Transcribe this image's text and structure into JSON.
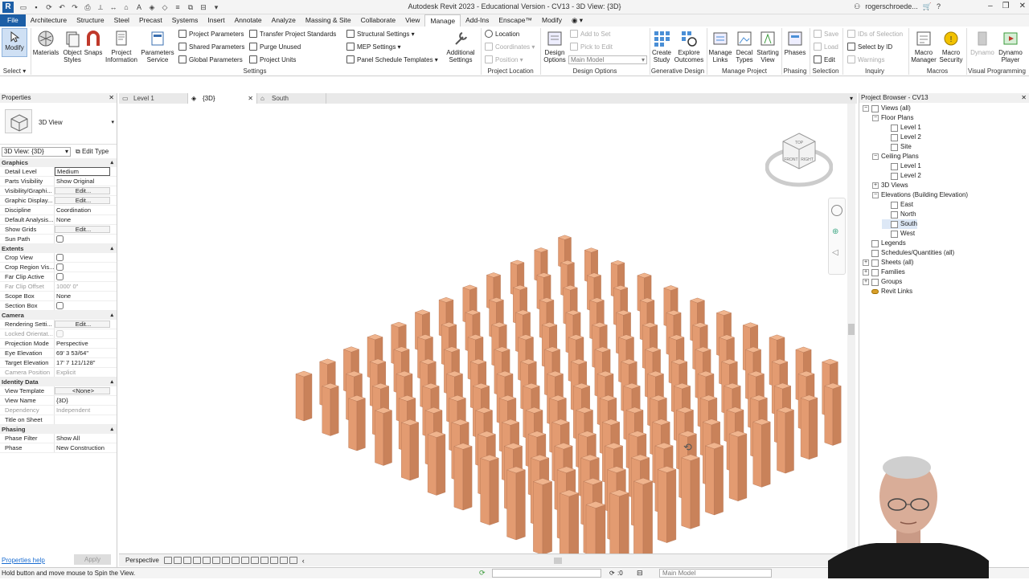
{
  "titlebar": {
    "app_logo": "R",
    "title": "Autodesk Revit 2023 - Educational Version - CV13 - 3D View: {3D}",
    "user": "rogerschroede...",
    "help": "?"
  },
  "ribbon_tabs": [
    "File",
    "Architecture",
    "Structure",
    "Steel",
    "Precast",
    "Systems",
    "Insert",
    "Annotate",
    "Analyze",
    "Massing & Site",
    "Collaborate",
    "View",
    "Manage",
    "Add-Ins",
    "Enscape™",
    "Modify"
  ],
  "active_tab": "Manage",
  "ribbon": {
    "select": {
      "modify": "Modify",
      "panel": "Select ▾"
    },
    "settings": {
      "materials": "Materials",
      "object_styles_1": "Object",
      "object_styles_2": "Styles",
      "snaps": "Snaps",
      "project_info_1": "Project",
      "project_info_2": "Information",
      "params_service_1": "Parameters",
      "params_service_2": "Service",
      "project_parameters": "Project  Parameters",
      "shared_parameters": "Shared  Parameters",
      "global_parameters": "Global  Parameters",
      "transfer_standards": "Transfer  Project Standards",
      "purge_unused": "Purge  Unused",
      "project_units": "Project  Units",
      "structural_settings": "Structural  Settings  ▾",
      "mep_settings": "MEP  Settings  ▾",
      "panel_schedule": "Panel Schedule  Templates  ▾",
      "additional_1": "Additional",
      "additional_2": "Settings",
      "panel": "Settings"
    },
    "project_location": {
      "location": "Location",
      "coordinates": "Coordinates  ▾",
      "position": "Position  ▾",
      "panel": "Project Location"
    },
    "design_options": {
      "design_1": "Design",
      "design_2": "Options",
      "add_to_set": "Add to Set",
      "pick_to_edit": "Pick to Edit",
      "main_model": "Main Model",
      "panel": "Design Options"
    },
    "generative": {
      "create_1": "Create",
      "create_2": "Study",
      "explore_1": "Explore",
      "explore_2": "Outcomes",
      "panel": "Generative Design"
    },
    "manage_project": {
      "manage_links_1": "Manage",
      "manage_links_2": "Links",
      "decal_1": "Decal",
      "decal_2": "Types",
      "starting_1": "Starting",
      "starting_2": "View",
      "panel": "Manage Project"
    },
    "phasing": {
      "phases": "Phases",
      "panel": "Phasing"
    },
    "selection": {
      "save": "Save",
      "load": "Load",
      "edit": "Edit",
      "panel": "Selection"
    },
    "inquiry": {
      "ids": "IDs of  Selection",
      "select_by_id": "Select  by ID",
      "warnings": "Warnings",
      "panel": "Inquiry"
    },
    "macros": {
      "manager_1": "Macro",
      "manager_2": "Manager",
      "security_1": "Macro",
      "security_2": "Security",
      "panel": "Macros"
    },
    "visual_programming": {
      "dynamo": "Dynamo",
      "player_1": "Dynamo",
      "player_2": "Player",
      "panel": "Visual Programming"
    }
  },
  "view_tabs": [
    {
      "label": "Level 1"
    },
    {
      "label": "{3D}",
      "close": "✕"
    },
    {
      "label": "South"
    }
  ],
  "properties": {
    "title": "Properties",
    "type_name": "3D View",
    "view_selector": "3D View: {3D}",
    "edit_type": "Edit Type",
    "groups": [
      {
        "name": "Graphics",
        "rows": [
          {
            "k": "Detail Level",
            "v": "Medium"
          },
          {
            "k": "Parts Visibility",
            "v": "Show Original"
          },
          {
            "k": "Visibility/Graphi...",
            "v": "Edit..."
          },
          {
            "k": "Graphic Display...",
            "v": "Edit..."
          },
          {
            "k": "Discipline",
            "v": "Coordination"
          },
          {
            "k": "Default Analysis...",
            "v": "None"
          },
          {
            "k": "Show Grids",
            "v": "Edit..."
          },
          {
            "k": "Sun Path",
            "v": ""
          }
        ]
      },
      {
        "name": "Extents",
        "rows": [
          {
            "k": "Crop View",
            "v": ""
          },
          {
            "k": "Crop Region Vis...",
            "v": ""
          },
          {
            "k": "Far Clip Active",
            "v": ""
          },
          {
            "k": "Far Clip Offset",
            "v": "1000'  0\""
          },
          {
            "k": "Scope Box",
            "v": "None"
          },
          {
            "k": "Section Box",
            "v": ""
          }
        ]
      },
      {
        "name": "Camera",
        "rows": [
          {
            "k": "Rendering Setti...",
            "v": "Edit..."
          },
          {
            "k": "Locked Orientat...",
            "v": ""
          },
          {
            "k": "Projection Mode",
            "v": "Perspective"
          },
          {
            "k": "Eye Elevation",
            "v": "69'  3 53/64\""
          },
          {
            "k": "Target Elevation",
            "v": "17'  7 121/128\""
          },
          {
            "k": "Camera Position",
            "v": "Explicit"
          }
        ]
      },
      {
        "name": "Identity Data",
        "rows": [
          {
            "k": "View Template",
            "v": "<None>"
          },
          {
            "k": "View Name",
            "v": "{3D}"
          },
          {
            "k": "Dependency",
            "v": "Independent"
          },
          {
            "k": "Title on Sheet",
            "v": ""
          }
        ]
      },
      {
        "name": "Phasing",
        "rows": [
          {
            "k": "Phase Filter",
            "v": "Show All"
          },
          {
            "k": "Phase",
            "v": "New Construction"
          }
        ]
      }
    ],
    "help_link": "Properties help",
    "apply": "Apply"
  },
  "viewcube": {
    "top": "TOP",
    "front": "FRONT",
    "right": "RIGHT"
  },
  "view_control": {
    "projection": "Perspective"
  },
  "browser": {
    "title": "Project Browser - CV13",
    "items": [
      {
        "label": "Views (all)"
      },
      {
        "label": "Floor Plans"
      },
      {
        "label": "Level 1"
      },
      {
        "label": "Level 2"
      },
      {
        "label": "Site"
      },
      {
        "label": "Ceiling Plans"
      },
      {
        "label": "Level 1"
      },
      {
        "label": "Level 2"
      },
      {
        "label": "3D Views"
      },
      {
        "label": "Elevations (Building Elevation)"
      },
      {
        "label": "East"
      },
      {
        "label": "North"
      },
      {
        "label": "South"
      },
      {
        "label": "West"
      },
      {
        "label": "Legends"
      },
      {
        "label": "Schedules/Quantities (all)"
      },
      {
        "label": "Sheets (all)"
      },
      {
        "label": "Families"
      },
      {
        "label": "Groups"
      },
      {
        "label": "Revit Links"
      }
    ]
  },
  "statusbar": {
    "hint": "Hold button and move mouse to Spin the View.",
    "zero": ":0",
    "model": "Main Model"
  },
  "colors": {
    "brand": "#1c5ea6",
    "column_top": "#f0b48d",
    "column_left": "#e39b71",
    "column_right": "#c9825a"
  }
}
